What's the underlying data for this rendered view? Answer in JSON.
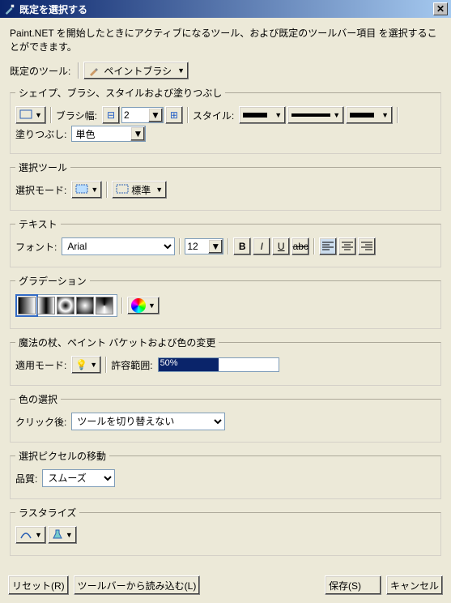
{
  "window": {
    "title": "既定を選択する"
  },
  "intro": "Paint.NET を開始したときにアクティブになるツール、および既定のツールバー項目 を選択することができます。",
  "defaultTool": {
    "label": "既定のツール:",
    "value": "ペイントブラシ"
  },
  "shape": {
    "legend": "シェイプ、ブラシ、スタイルおよび塗りつぶし",
    "brushWidthLabel": "ブラシ幅:",
    "brushWidthValue": "2",
    "styleLabel": "スタイル:",
    "fillLabel": "塗りつぶし:",
    "fillValue": "単色"
  },
  "selection": {
    "legend": "選択ツール",
    "modeLabel": "選択モード:",
    "normalLabel": "標準"
  },
  "text": {
    "legend": "テキスト",
    "fontLabel": "フォント:",
    "fontValue": "Arial",
    "sizeValue": "12"
  },
  "gradient": {
    "legend": "グラデーション"
  },
  "magic": {
    "legend": "魔法の杖、ペイント バケットおよび色の変更",
    "applyLabel": "適用モード:",
    "toleranceLabel": "許容範囲:",
    "toleranceValue": "50%"
  },
  "colorpick": {
    "legend": "色の選択",
    "afterLabel": "クリック後:",
    "afterValue": "ツールを切り替えない"
  },
  "movesel": {
    "legend": "選択ピクセルの移動",
    "qualityLabel": "品質:",
    "qualityValue": "スムーズ"
  },
  "raster": {
    "legend": "ラスタライズ"
  },
  "footer": {
    "reset": "リセット(R)",
    "loadToolbar": "ツールバーから読み込む(L)",
    "save": "保存(S)",
    "cancel": "キャンセル"
  }
}
